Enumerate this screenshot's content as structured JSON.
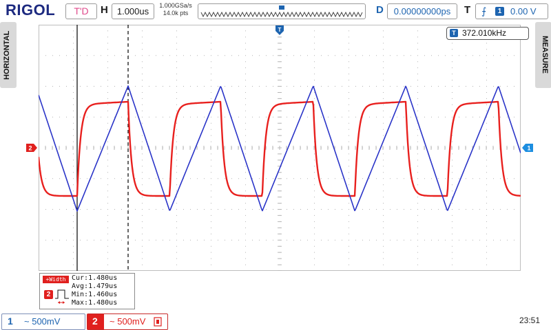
{
  "header": {
    "logo": "RIGOL",
    "run_state": "T'D",
    "horizontal_label": "H",
    "timebase": "1.000us",
    "sample_rate": "1.000GSa/s",
    "memory_depth": "14.0k pts",
    "delay_label": "D",
    "delay_value": "0.00000000ps",
    "trigger_label": "T",
    "trigger_edge": "⨍",
    "trigger_channel": "1",
    "trigger_level": "0.00 V"
  },
  "side_menus": {
    "left": "HORIZONTAL",
    "right": "MEASURE"
  },
  "measurement": {
    "badge": "T",
    "frequency": "372.010kHz"
  },
  "statistics": {
    "label": "+Width",
    "channel": "2",
    "cur": "Cur:1.480us",
    "avg": "Avg:1.479us",
    "min": "Min:1.460us",
    "max": "Max:1.480us"
  },
  "channels": [
    {
      "number": "1",
      "coupling": "~",
      "scale": "500mV",
      "color": "#1d64b0"
    },
    {
      "number": "2",
      "coupling": "~",
      "scale": "500mV",
      "color": "#e0201e"
    }
  ],
  "markers": {
    "ch2_ground": "2",
    "trigger_level_marker": "1"
  },
  "clock": "23:51",
  "colors": {
    "ch1_trace": "#2a34c8",
    "ch2_trace": "#e8201e",
    "grid_dot": "#a9a9a9",
    "cursor": "#000000"
  }
}
